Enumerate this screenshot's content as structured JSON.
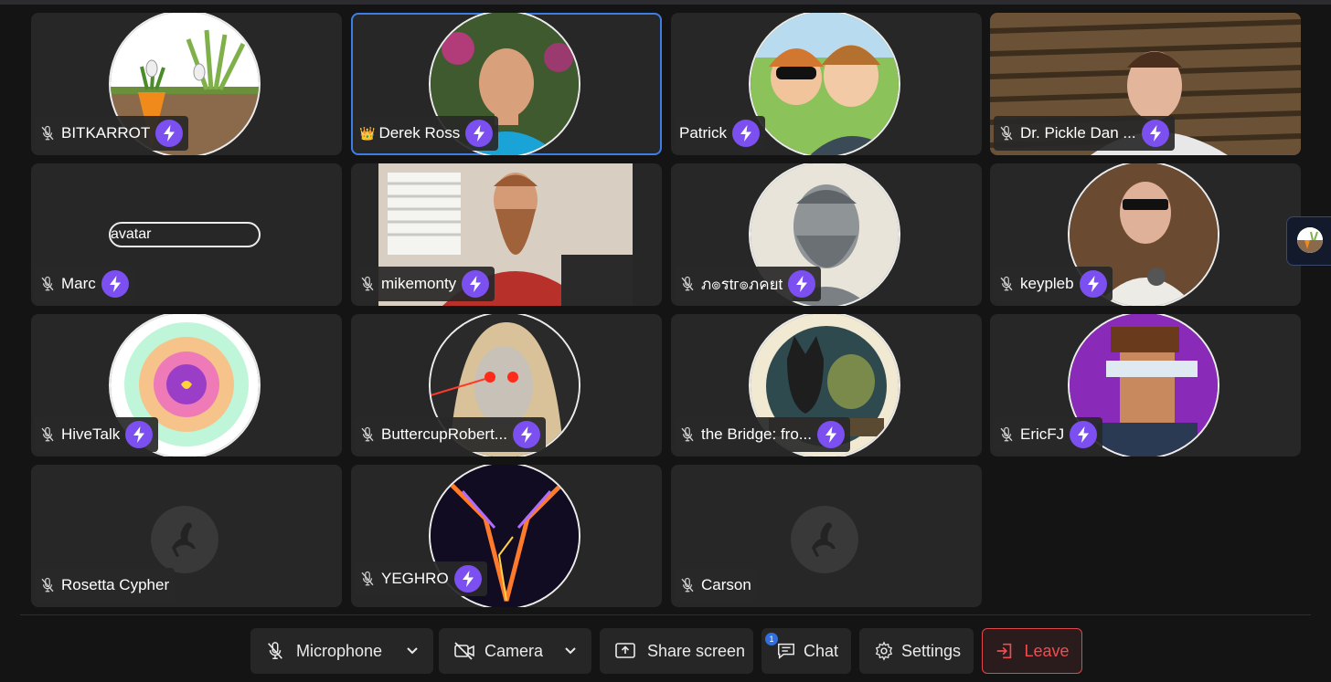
{
  "participants": [
    {
      "name": "BITKARROT",
      "avatar": "carrot-bunnies-avatar"
    },
    {
      "name": "Derek Ross",
      "host_icon": "👑",
      "avatar": "bald-man-avatar",
      "active": true
    },
    {
      "name": "Patrick",
      "avatar": "anime-couple-avatar"
    },
    {
      "name": "Dr. Pickle Dan ...",
      "avatar": "webcam-man-avatar"
    },
    {
      "name": "Marc",
      "avatar_alt": "avatar"
    },
    {
      "name": "mikemonty",
      "avatar": "bearded-man-webcam"
    },
    {
      "name": "ภ๏รtг๏ภคยt",
      "avatar": "silver-bust-avatar"
    },
    {
      "name": "keypleb",
      "avatar": "sunglasses-man-avatar"
    },
    {
      "name": "HiveTalk",
      "avatar": "flower-logo-avatar"
    },
    {
      "name": "ButtercupRobert...",
      "avatar": "laser-eyes-avatar"
    },
    {
      "name": "the Bridge: fro...",
      "avatar": "cats-avatar"
    },
    {
      "name": "EricFJ",
      "avatar": "pixel-art-avatar"
    },
    {
      "name": "Rosetta Cypher",
      "avatar": "ostrich-placeholder"
    },
    {
      "name": "YEGHRO",
      "avatar": "lightning-avatar"
    },
    {
      "name": "Carson",
      "avatar": "ostrich-placeholder"
    }
  ],
  "controls": {
    "microphone": "Microphone",
    "camera": "Camera",
    "share_screen": "Share screen",
    "chat": "Chat",
    "chat_badge": "1",
    "settings": "Settings",
    "leave": "Leave"
  },
  "colors": {
    "zap": "#7b4ff0",
    "active_border": "#3d7ee6",
    "leave": "#ef4e51",
    "tile_bg": "#272727"
  }
}
